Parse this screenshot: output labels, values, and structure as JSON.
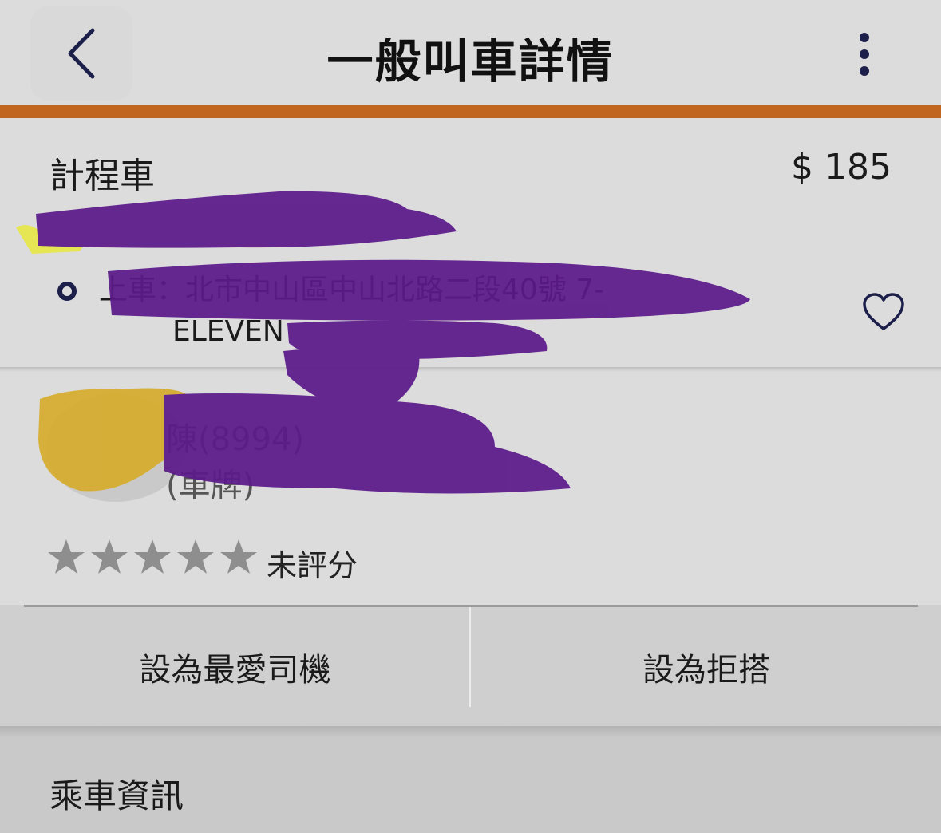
{
  "header": {
    "title": "一般叫車詳情",
    "back_icon": "chevron-left-icon",
    "more_icon": "more-vertical-icon"
  },
  "colors": {
    "accent": "#c0661f",
    "icon_dark": "#1b1f4a",
    "redaction_purple": "#5b1a8a",
    "redaction_yellow": "#d6ac2e"
  },
  "trip": {
    "vehicle_type": "計程車",
    "price": "$ 185",
    "address_line1": "上車：北市中山區中山北路二段40號 7-",
    "address_line2": "ELEVEN",
    "favorite_icon": "heart-outline-icon"
  },
  "driver": {
    "name": "陳(8994)",
    "car": "(車牌)",
    "rating": 0,
    "rating_max": 5,
    "rating_text": "未評分"
  },
  "actions": {
    "favorite_driver": "設為最愛司機",
    "block_driver": "設為拒搭"
  },
  "ride_info": {
    "title": "乘車資訊"
  }
}
